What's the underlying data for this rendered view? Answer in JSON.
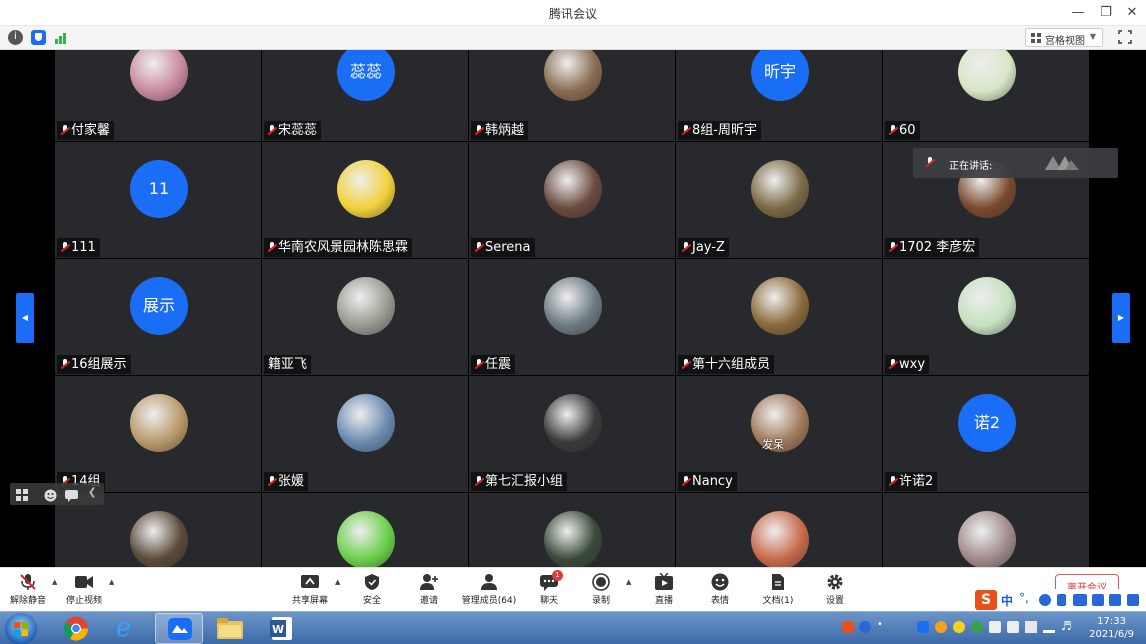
{
  "window": {
    "title": "腾讯会议"
  },
  "topbar": {
    "view_label": "宫格视图"
  },
  "speaking": {
    "label": "正在讲话:"
  },
  "tiles": [
    {
      "name": "付家馨",
      "avatar_text": "",
      "avatar_color": "#c98a9f",
      "muted": true
    },
    {
      "name": "宋蕊蕊",
      "avatar_text": "蕊蕊",
      "avatar_color": "#1a6ef5",
      "muted": true
    },
    {
      "name": "韩炳越",
      "avatar_text": "",
      "avatar_color": "#8a6c52",
      "muted": true
    },
    {
      "name": "8组-周昕宇",
      "avatar_text": "昕宇",
      "avatar_color": "#1a6ef5",
      "muted": true
    },
    {
      "name": "60",
      "avatar_text": "",
      "avatar_color": "#d8e6c6",
      "muted": true
    },
    {
      "name": "111",
      "avatar_text": "11",
      "avatar_color": "#1a6ef5",
      "muted": true
    },
    {
      "name": "华南农风景园林陈思霖",
      "avatar_text": "",
      "avatar_color": "#f2d23a",
      "muted": true
    },
    {
      "name": "Serena",
      "avatar_text": "",
      "avatar_color": "#6a4a3e",
      "muted": true
    },
    {
      "name": "Jay-Z",
      "avatar_text": "",
      "avatar_color": "#7a6a45",
      "muted": true
    },
    {
      "name": "1702 李彦宏",
      "avatar_text": "",
      "avatar_color": "#7a4a2e",
      "muted": true
    },
    {
      "name": "16组展示",
      "avatar_text": "展示",
      "avatar_color": "#1a6ef5",
      "muted": true
    },
    {
      "name": "籍亚飞",
      "avatar_text": "",
      "avatar_color": "#9a9a92",
      "muted": false
    },
    {
      "name": "任震",
      "avatar_text": "",
      "avatar_color": "#6c7a82",
      "muted": true
    },
    {
      "name": "第十六组成员",
      "avatar_text": "",
      "avatar_color": "#8a6a3a",
      "muted": true
    },
    {
      "name": "wxy",
      "avatar_text": "",
      "avatar_color": "#c6e0c0",
      "muted": true
    },
    {
      "name": "14组",
      "avatar_text": "",
      "avatar_color": "#b89a6a",
      "muted": true
    },
    {
      "name": "张媛",
      "avatar_text": "",
      "avatar_color": "#6a8ab0",
      "muted": true
    },
    {
      "name": "第七汇报小组",
      "avatar_text": "",
      "avatar_color": "#3a3a3a",
      "muted": true
    },
    {
      "name": "Nancy",
      "avatar_text": "",
      "avatar_color": "#a07a5a",
      "muted": true
    },
    {
      "name": "许诺2",
      "avatar_text": "诺2",
      "avatar_color": "#1a6ef5",
      "muted": true
    },
    {
      "name": "",
      "avatar_text": "",
      "avatar_color": "#5a4a3a",
      "muted": false
    },
    {
      "name": "",
      "avatar_text": "",
      "avatar_color": "#6ccf4a",
      "muted": false
    },
    {
      "name": "",
      "avatar_text": "",
      "avatar_color": "#3a4a3a",
      "muted": false
    },
    {
      "name": "",
      "avatar_text": "",
      "avatar_color": "#c86a4a",
      "muted": false
    },
    {
      "name": "",
      "avatar_text": "",
      "avatar_color": "#a08a8a",
      "muted": false
    }
  ],
  "nancy_overlay": "发呆",
  "toolbar": {
    "unmute": "解除静音",
    "stop_video": "停止视频",
    "share_screen": "共享屏幕",
    "security": "安全",
    "invite": "邀请",
    "manage_members": "管理成员(64)",
    "chat": "聊天",
    "chat_badge": "1",
    "record": "录制",
    "live": "直播",
    "reactions": "表情",
    "docs": "文档(1)",
    "settings": "设置",
    "leave": "离开会议"
  },
  "ime": {
    "lang": "中"
  },
  "clock": {
    "time": "17:33",
    "date": "2021/6/9"
  }
}
